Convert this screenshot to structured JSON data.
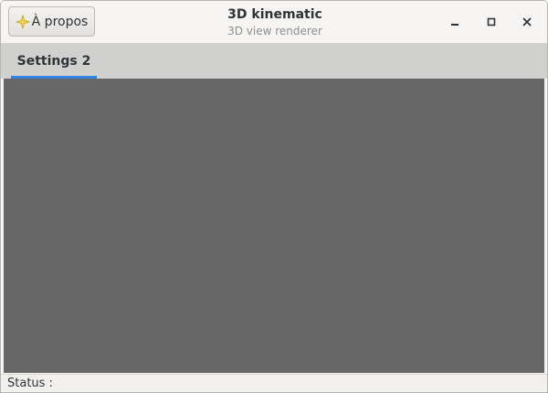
{
  "window": {
    "title": "3D kinematic",
    "subtitle": "3D view renderer"
  },
  "header": {
    "about_button": {
      "label": "À propos",
      "icon": "star-icon"
    },
    "controls": {
      "minimize_icon": "minimize-icon",
      "maximize_icon": "maximize-icon",
      "close_icon": "close-icon"
    }
  },
  "tabs": [
    {
      "label": "Settings 2",
      "active": true
    }
  ],
  "viewport": {
    "background_color": "#666666"
  },
  "statusbar": {
    "label": "Status :"
  },
  "colors": {
    "accent": "#3584e4",
    "star": "#f5c211"
  }
}
